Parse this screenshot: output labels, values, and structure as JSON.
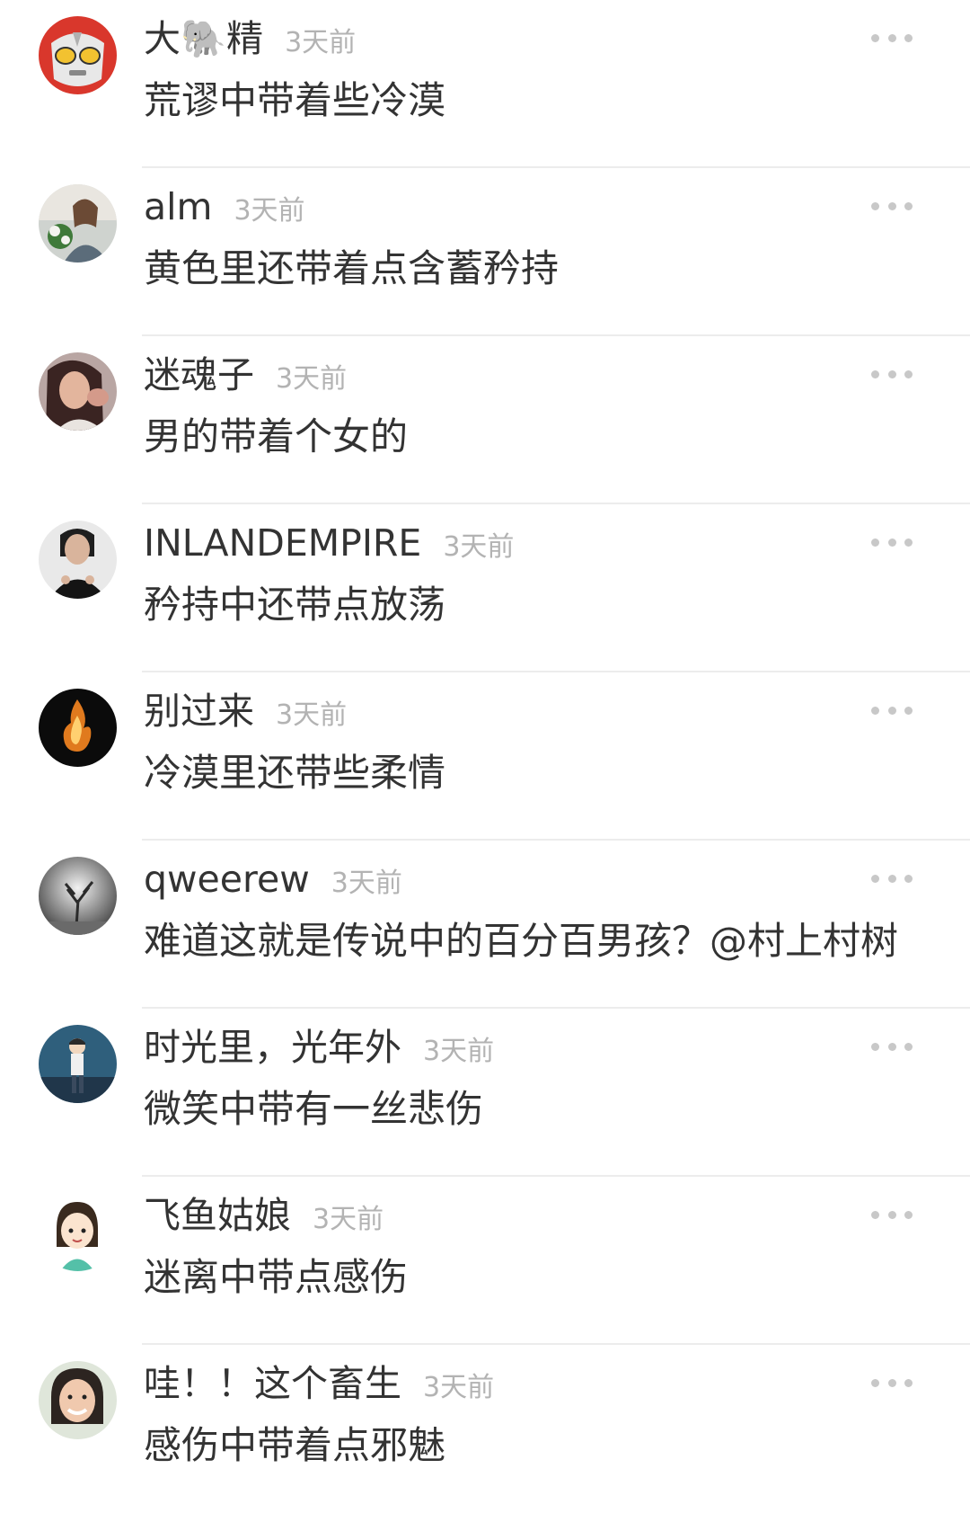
{
  "comments": [
    {
      "user": "大🐘精",
      "time": "3天前",
      "text": "荒谬中带着些冷漠",
      "avatar_icon": "robot-hero-mask-icon"
    },
    {
      "user": "alm",
      "time": "3天前",
      "text": "黄色里还带着点含蓄矜持",
      "avatar_icon": "woman-with-flowers-photo"
    },
    {
      "user": "迷魂子",
      "time": "3天前",
      "text": "男的带着个女的",
      "avatar_icon": "woman-portrait-photo"
    },
    {
      "user": "INLANDEMPIRE",
      "time": "3天前",
      "text": "矜持中还带点放荡",
      "avatar_icon": "woman-dark-portrait-photo"
    },
    {
      "user": "别过来",
      "time": "3天前",
      "text": "冷漠里还带些柔情",
      "avatar_icon": "fire-on-black-photo"
    },
    {
      "user": "qweerew",
      "time": "3天前",
      "text": "难道这就是传说中的百分百男孩？@村上村树",
      "avatar_icon": "lone-tree-photo"
    },
    {
      "user": "时光里，光年外",
      "time": "3天前",
      "text": "微笑中带有一丝悲伤",
      "avatar_icon": "anime-boy-illustration"
    },
    {
      "user": "飞鱼姑娘",
      "time": "3天前",
      "text": "迷离中带点感伤",
      "avatar_icon": "cartoon-girl-illustration"
    },
    {
      "user": "哇！！这个畜生",
      "time": "3天前",
      "text": "感伤中带着点邪魅",
      "avatar_icon": "smiling-woman-photo"
    }
  ],
  "more_icon": "ellipsis-icon"
}
